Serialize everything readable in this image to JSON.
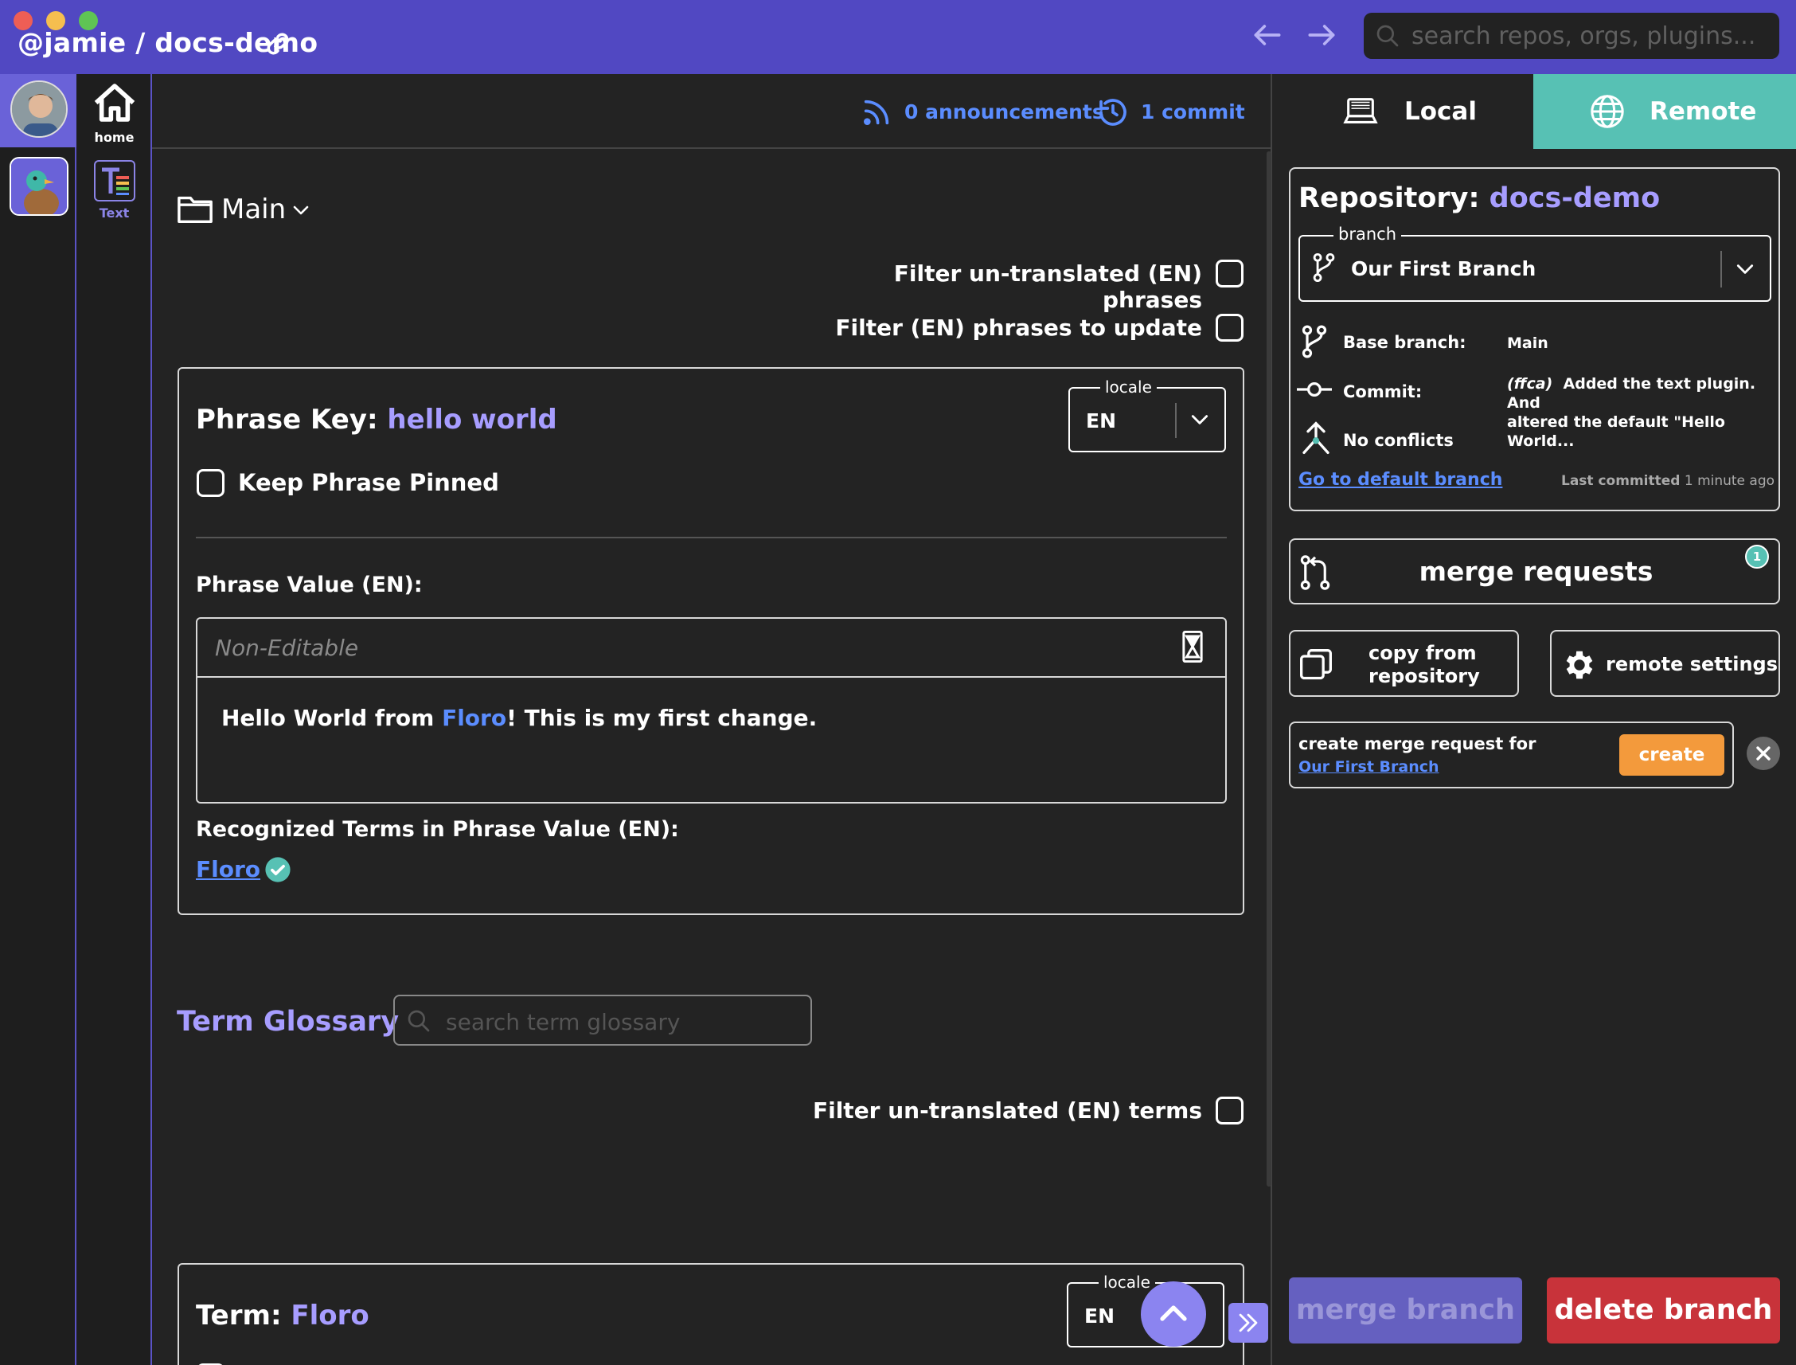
{
  "titlebar": {
    "repo_path": "@jamie / docs-demo",
    "search_placeholder": "search repos, orgs, plugins..."
  },
  "rail": {
    "home_label": "home",
    "text_label": "Text"
  },
  "main_topbar": {
    "announcements": "0 announcements",
    "commits": "1 commit"
  },
  "tabs": {
    "local": "Local",
    "remote": "Remote"
  },
  "content": {
    "folder_label": "Main",
    "filter_untranslated_phrases": "Filter un-translated (EN) phrases",
    "filter_phrases_update": "Filter (EN) phrases to update",
    "phrase": {
      "key_label": "Phrase Key",
      "key_value": "hello world",
      "locale_legend": "locale",
      "locale_value": "EN",
      "keep_pinned": "Keep Phrase Pinned",
      "value_label": "Phrase Value (EN):",
      "non_editable": "Non-Editable",
      "value_before": "Hello World from ",
      "value_link": "Floro",
      "value_after": "! This is my first change.",
      "recognized_label": "Recognized Terms in Phrase Value (EN):",
      "recognized_term": "Floro"
    },
    "glossary": {
      "title": "Term Glossary",
      "search_placeholder": "search term glossary",
      "filter_untranslated_terms": "Filter un-translated (EN) terms"
    },
    "term": {
      "label": "Term",
      "value": "Floro",
      "locale_legend": "locale",
      "locale_value": "EN"
    }
  },
  "repo_panel": {
    "repository_label": "Repository",
    "repository_name": "docs-demo",
    "branch_legend": "branch",
    "branch_value": "Our First Branch",
    "base_branch_label": "Base branch:",
    "base_branch_value": "Main",
    "commit_label": "Commit:",
    "commit_sha": "(ffca)",
    "commit_message_line1": "Added the text plugin. And",
    "commit_message_line2": "altered the default \"Hello World...",
    "no_conflicts": "No conflicts",
    "go_default": "Go to default branch",
    "last_committed_label": "Last committed",
    "last_committed_value": "1 minute ago",
    "merge_requests": "merge requests",
    "merge_requests_count": "1",
    "copy_from_line1": "copy from",
    "copy_from_line2": "repository",
    "remote_settings": "remote settings",
    "create_mr_label": "create merge request for",
    "create_mr_branch": "Our First Branch",
    "create_button": "create",
    "merge_branch": "merge branch",
    "delete_branch": "delete branch"
  },
  "colors": {
    "titlebar": "#5148c2",
    "accent_purple": "#a79dff",
    "link_blue": "#5b8dff",
    "remote_teal": "#57c1b4",
    "create_orange": "#f39a3c",
    "delete_red": "#c8333a",
    "merge_disabled": "#6560c0"
  }
}
